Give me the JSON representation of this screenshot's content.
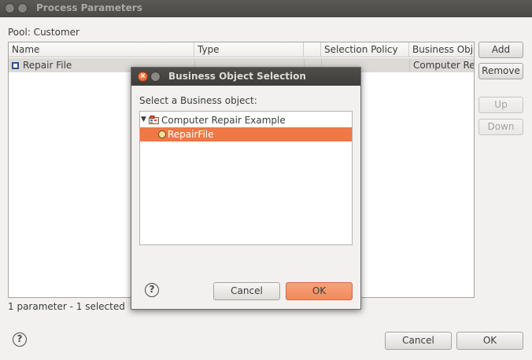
{
  "window": {
    "title": "Process Parameters"
  },
  "pool_label": "Pool: Customer",
  "table": {
    "columns": [
      "Name",
      "Type",
      "",
      "Selection Policy",
      "Business Objec"
    ],
    "rows": [
      {
        "name": "Repair File",
        "type": "",
        "col3": "",
        "selection_policy": "",
        "business_object": "Computer Rep"
      }
    ]
  },
  "side_buttons": {
    "add": "Add",
    "remove": "Remove",
    "up": "Up",
    "down": "Down"
  },
  "status": "1 parameter - 1  selected",
  "footer": {
    "help": "?",
    "cancel": "Cancel",
    "ok": "OK"
  },
  "dialog": {
    "title": "Business Object Selection",
    "prompt": "Select a Business object:",
    "tree": {
      "root": "Computer Repair Example",
      "child": "RepairFile"
    },
    "help": "?",
    "cancel": "Cancel",
    "ok": "OK"
  },
  "icons": {
    "window_close": "close-icon",
    "window_minimize": "minimize-icon",
    "parameter": "parameter-icon",
    "tree_expand": "expand-arrow-icon",
    "package": "package-icon",
    "business_object": "business-object-icon",
    "help": "help-icon"
  },
  "colors": {
    "selection": "#f07746",
    "ok_button": "#f08a5c",
    "titlebar": "#4b4a46"
  }
}
